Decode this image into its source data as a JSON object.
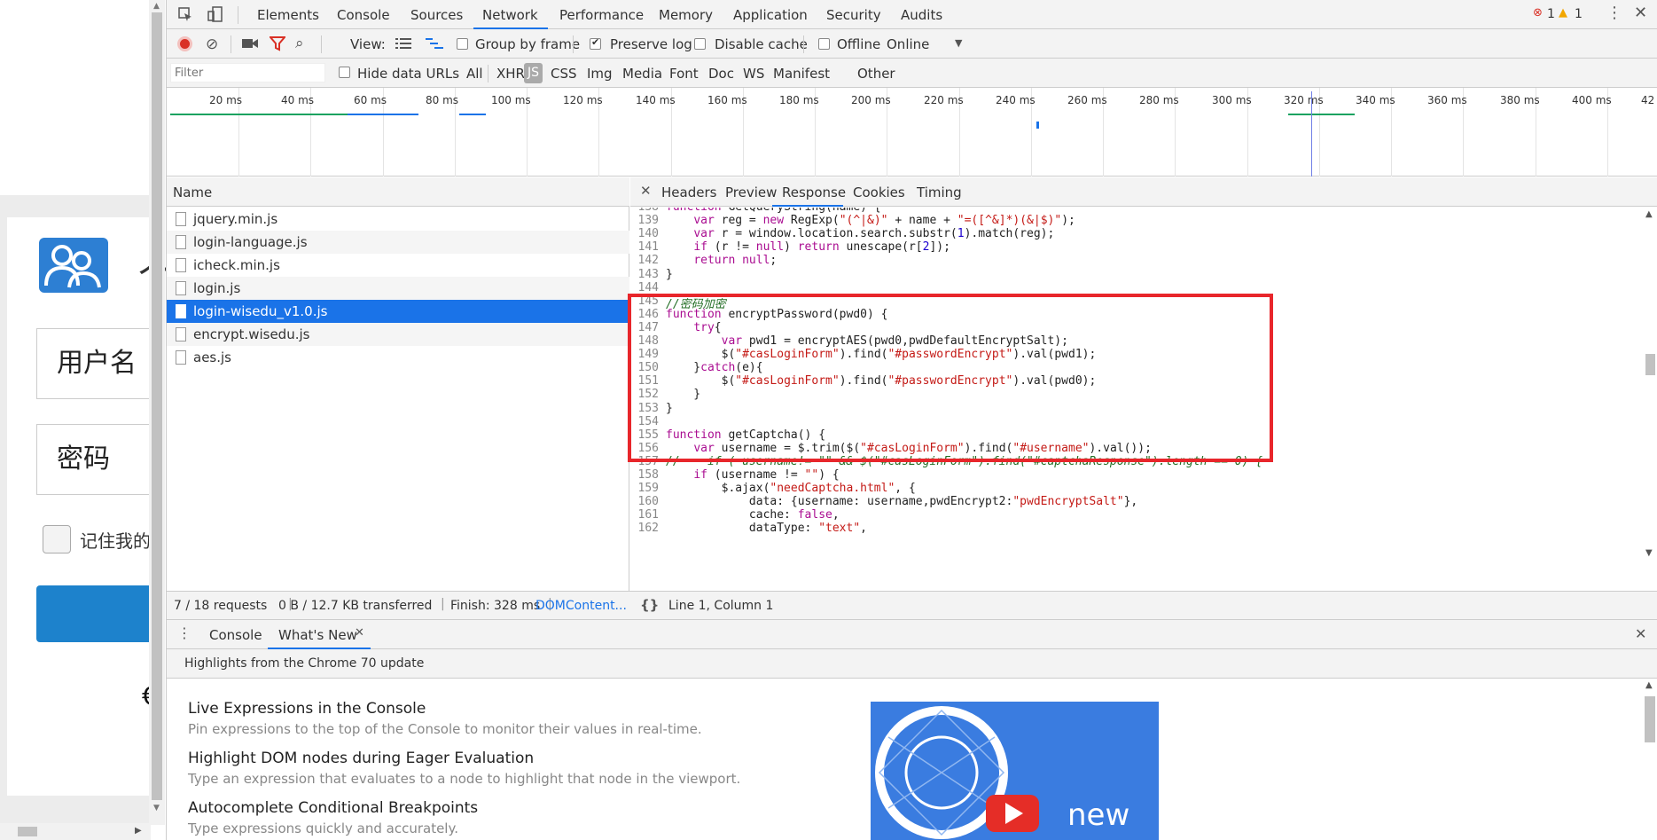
{
  "page": {
    "username_label": "用户名",
    "password_label": "密码",
    "remember_label": "记住我的",
    "logo_char": "个",
    "partial_char": "€"
  },
  "devtools": {
    "tabs": [
      "Elements",
      "Console",
      "Sources",
      "Network",
      "Performance",
      "Memory",
      "Application",
      "Security",
      "Audits"
    ],
    "active_tab": "Network",
    "errors": "1",
    "warnings": "1",
    "toolbar": {
      "view_label": "View:",
      "group_by_frame": "Group by frame",
      "preserve_log": "Preserve log",
      "disable_cache": "Disable cache",
      "offline": "Offline",
      "throttle": "Online"
    },
    "filter": {
      "placeholder": "Filter",
      "hide_data_urls": "Hide data URLs",
      "types": [
        "All",
        "XHR",
        "JS",
        "CSS",
        "Img",
        "Media",
        "Font",
        "Doc",
        "WS",
        "Manifest",
        "Other"
      ],
      "active_type": "JS"
    },
    "timeline_ticks": [
      "20 ms",
      "40 ms",
      "60 ms",
      "80 ms",
      "100 ms",
      "120 ms",
      "140 ms",
      "160 ms",
      "180 ms",
      "200 ms",
      "220 ms",
      "240 ms",
      "260 ms",
      "280 ms",
      "300 ms",
      "320 ms",
      "340 ms",
      "360 ms",
      "380 ms",
      "400 ms",
      "42"
    ],
    "list": {
      "header": "Name",
      "files": [
        "jquery.min.js",
        "login-language.js",
        "icheck.min.js",
        "login.js",
        "login-wisedu_v1.0.js",
        "encrypt.wisedu.js",
        "aes.js"
      ],
      "selected": "login-wisedu_v1.0.js"
    },
    "detail_tabs": [
      "Headers",
      "Preview",
      "Response",
      "Cookies",
      "Timing"
    ],
    "active_detail_tab": "Response",
    "code_lines": [
      {
        "n": "138",
        "t": "function GetQueryString(name) {"
      },
      {
        "n": "139",
        "t": "    var reg = new RegExp(\"(^|&)\" + name + \"=([^&]*)(&|$)\");"
      },
      {
        "n": "140",
        "t": "    var r = window.location.search.substr(1).match(reg);"
      },
      {
        "n": "141",
        "t": "    if (r != null) return unescape(r[2]);"
      },
      {
        "n": "142",
        "t": "    return null;"
      },
      {
        "n": "143",
        "t": "}"
      },
      {
        "n": "144",
        "t": ""
      },
      {
        "n": "145",
        "t": "//密码加密"
      },
      {
        "n": "146",
        "t": "function encryptPassword(pwd0) {"
      },
      {
        "n": "147",
        "t": "    try{"
      },
      {
        "n": "148",
        "t": "        var pwd1 = encryptAES(pwd0,pwdDefaultEncryptSalt);"
      },
      {
        "n": "149",
        "t": "        $(\"#casLoginForm\").find(\"#passwordEncrypt\").val(pwd1);"
      },
      {
        "n": "150",
        "t": "    }catch(e){"
      },
      {
        "n": "151",
        "t": "        $(\"#casLoginForm\").find(\"#passwordEncrypt\").val(pwd0);"
      },
      {
        "n": "152",
        "t": "    }"
      },
      {
        "n": "153",
        "t": "}"
      },
      {
        "n": "154",
        "t": ""
      },
      {
        "n": "155",
        "t": "function getCaptcha() {"
      },
      {
        "n": "156",
        "t": "    var username = $.trim($(\"#casLoginForm\").find(\"#username\").val());"
      },
      {
        "n": "157",
        "t": "//    if ( username!= \"\" && $(\"#casLoginForm\").find(\"#captchaResponse\").length == 0) {"
      },
      {
        "n": "158",
        "t": "    if (username != \"\") {"
      },
      {
        "n": "159",
        "t": "        $.ajax(\"needCaptcha.html\", {"
      },
      {
        "n": "160",
        "t": "            data: {username: username,pwdEncrypt2:\"pwdEncryptSalt\"},"
      },
      {
        "n": "161",
        "t": "            cache: false,"
      },
      {
        "n": "162",
        "t": "            dataType: \"text\","
      }
    ],
    "status": {
      "requests": "7 / 18 requests",
      "transferred": "0 B / 12.7 KB transferred",
      "finish": "Finish: 328 ms",
      "domcontent": "DOMContent...",
      "position": "Line 1, Column 1"
    },
    "drawer": {
      "tabs": [
        "Console",
        "What's New"
      ],
      "active": "What's New",
      "subheader": "Highlights from the Chrome 70 update",
      "features": [
        {
          "title": "Live Expressions in the Console",
          "desc": "Pin expressions to the top of the Console to monitor their values in real-time."
        },
        {
          "title": "Highlight DOM nodes during Eager Evaluation",
          "desc": "Type an expression that evaluates to a node to highlight that node in the viewport."
        },
        {
          "title": "Autocomplete Conditional Breakpoints",
          "desc": "Type expressions quickly and accurately."
        }
      ],
      "promo_text": "new"
    }
  }
}
